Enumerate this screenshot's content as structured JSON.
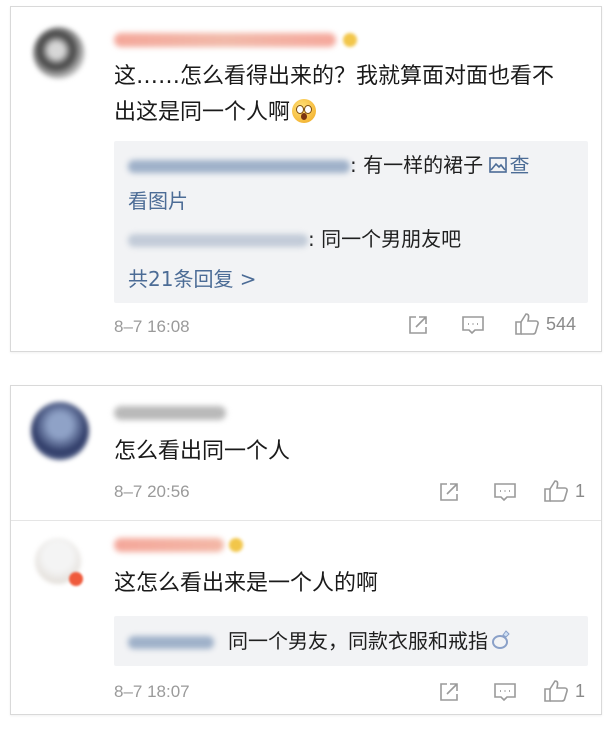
{
  "comments": [
    {
      "text_line1": "这……怎么看得出来的？我就算面对面也看不",
      "text_line2": "出这是同一个人啊",
      "emoji_icon": "astonished-face-icon",
      "replies": [
        {
          "text_part1": ": 有一样的裙子 ",
          "view_image_label": "查",
          "view_image_label2": "看图片",
          "image_icon": "image-icon"
        },
        {
          "text": ": 同一个男朋友吧"
        }
      ],
      "more_replies_label": "共21条回复 >",
      "time": "8–7 16:08",
      "like_count": "544"
    },
    {
      "text": "怎么看出同一个人",
      "time": "8–7 20:56",
      "like_count": "1",
      "nested_reply": {
        "text": "这怎么看出来是一个人的啊",
        "reply_text": "同一个男友，同款衣服和戒指",
        "ring_icon": "ring-icon",
        "time": "8–7 18:07",
        "like_count": "1"
      }
    }
  ],
  "colors": {
    "link": "#4c6c96",
    "reply_bg": "#f2f3f5",
    "meta": "#9a9a9a"
  }
}
